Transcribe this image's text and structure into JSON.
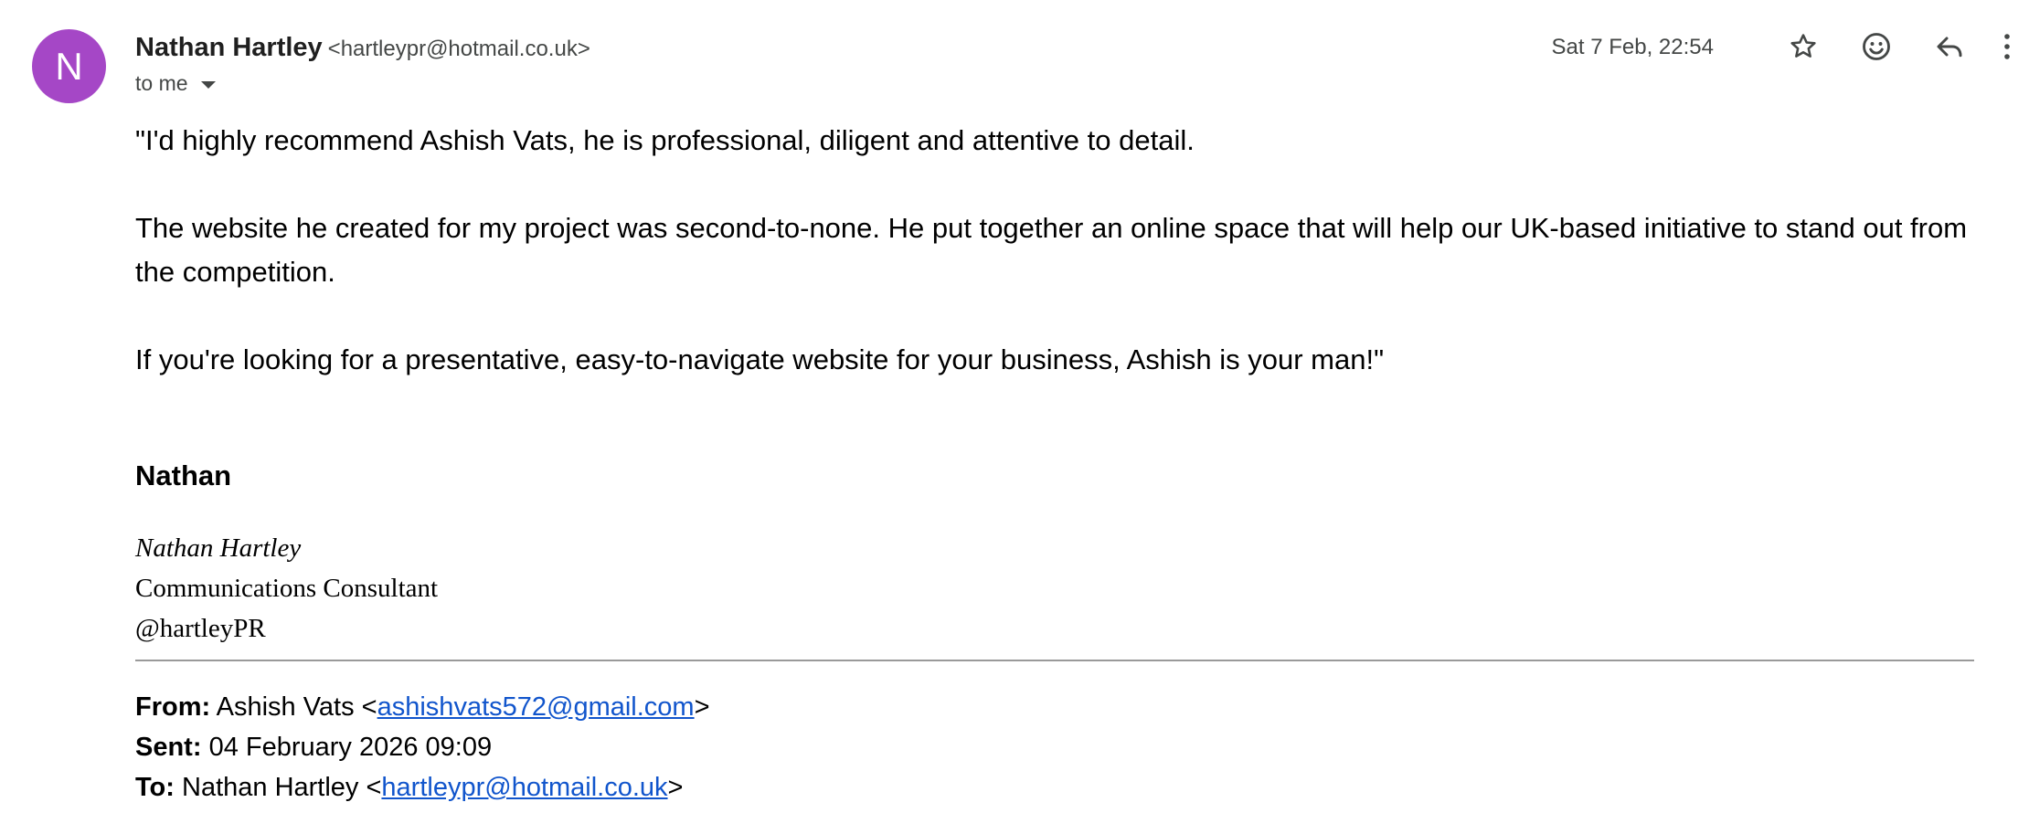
{
  "header": {
    "avatar_letter": "N",
    "avatar_color": "#a547c6",
    "sender_name": "Nathan Hartley",
    "sender_email": "<hartleypr@hotmail.co.uk>",
    "recipient_label": "to me",
    "timestamp": "Sat 7 Feb, 22:54",
    "actions": [
      "star-icon",
      "emoji-icon",
      "reply-icon",
      "more-vert-icon"
    ]
  },
  "body": {
    "paragraphs": [
      "\"I'd highly recommend Ashish Vats, he is professional, diligent and attentive to detail.",
      "The website he created for my project was second-to-none. He put together an online space that will help our UK-based initiative to stand out from the competition.",
      "If you're looking for a presentative, easy-to-navigate website for your business, Ashish is your man!\""
    ]
  },
  "signature": {
    "short_name": "Nathan",
    "full_name": "Nathan Hartley",
    "title": "Communications Consultant",
    "handle": "@hartleyPR"
  },
  "quoted_header": {
    "from_label": "From:",
    "from_name": "Ashish Vats <",
    "from_email": "ashishvats572@gmail.com",
    "from_close": ">",
    "sent_label": "Sent:",
    "sent_value": "04 February 2026 09:09",
    "to_label": "To:",
    "to_name": "Nathan Hartley <",
    "to_email": "hartleypr@hotmail.co.uk",
    "to_close": ">"
  },
  "colors": {
    "link": "#1155cc",
    "meta_text": "#444746",
    "divider": "#9a9a9a"
  }
}
